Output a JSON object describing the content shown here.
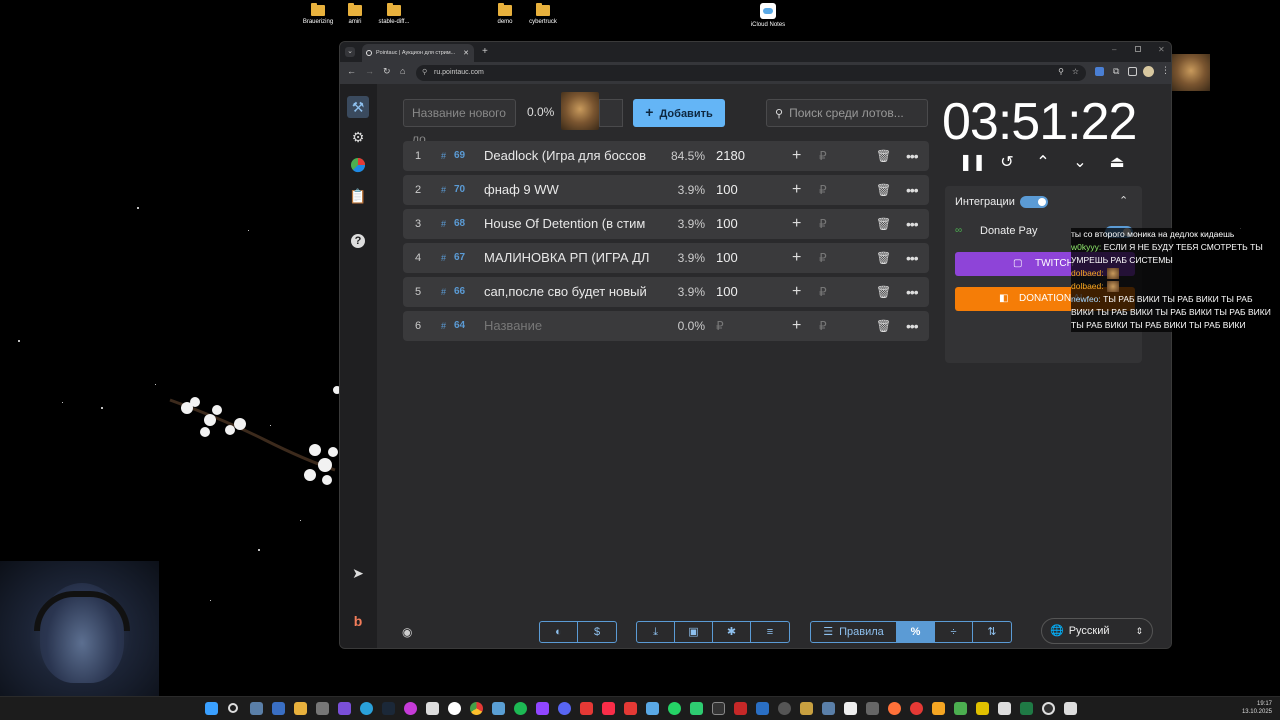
{
  "desktop": {
    "icons": [
      {
        "label": "Brauerizing"
      },
      {
        "label": "amiri"
      },
      {
        "label": "stable-diff..."
      },
      {
        "label": "demo"
      },
      {
        "label": "cybertruck"
      },
      {
        "label": "iCloud Notes"
      }
    ]
  },
  "browser": {
    "tab_title": "Pointauc | Аукцион для стрим...",
    "url": "ru.pointauc.com"
  },
  "toolbar": {
    "new_lot_placeholder": "Название нового ло",
    "new_lot_percent": "0.0%",
    "add_label": "Добавить",
    "search_placeholder": "Поиск среди лотов..."
  },
  "lots": [
    {
      "num": "1",
      "id": "69",
      "name": "Deadlock (Игра для боссов",
      "percent": "84.5%",
      "amount": "2180",
      "progress": 0.845
    },
    {
      "num": "2",
      "id": "70",
      "name": "фнаф 9 WW",
      "percent": "3.9%",
      "amount": "100",
      "progress": 0.039
    },
    {
      "num": "3",
      "id": "68",
      "name": "House Of Detention (в стим",
      "percent": "3.9%",
      "amount": "100",
      "progress": 0.039
    },
    {
      "num": "4",
      "id": "67",
      "name": "МАЛИНОВКА РП (ИГРА ДЛ",
      "percent": "3.9%",
      "amount": "100",
      "progress": 0.039
    },
    {
      "num": "5",
      "id": "66",
      "name": "сап,после сво будет новый",
      "percent": "3.9%",
      "amount": "100",
      "progress": 0.039
    },
    {
      "num": "6",
      "id": "64",
      "name": "Название",
      "percent": "0.0%",
      "amount": "₽",
      "progress": 0.0
    }
  ],
  "currency_symbol": "₽",
  "timer": "03:51:22",
  "integrations": {
    "title": "Интеграции",
    "donatepay_label": "Donate Pay",
    "twitch_label": "TWITCH",
    "donationalerts_label": "DONATION AL"
  },
  "bottom": {
    "rules_label": "Правила",
    "language": "Русский"
  },
  "chat": [
    {
      "user": "",
      "text": "ты со второго моника на дедлок кидаешь",
      "color": "#ffffff"
    },
    {
      "user": "w0kyyy:",
      "text": " ЕСЛИ Я НЕ БУДУ ТЕБЯ СМОТРЕТЬ ТЫ УМРЕШЬ РАБ СИСТЕМЫ",
      "color": "#8ee86a"
    },
    {
      "user": "dolbaed:",
      "text": "",
      "color": "#f5a623"
    },
    {
      "user": "dolbaed:",
      "text": "",
      "color": "#f5a623"
    },
    {
      "user": "newfeo:",
      "text": " ТЫ РАБ ВИКИ ТЫ РАБ ВИКИ ТЫ РАБ ВИКИ ТЫ РАБ ВИКИ ТЫ РАБ ВИКИ ТЫ РАБ ВИКИ ТЫ РАБ ВИКИ ТЫ РАБ ВИКИ ТЫ РАБ ВИКИ",
      "color": "#a8d8ff"
    }
  ],
  "clock": {
    "time": "19:17",
    "date": "13.10.2025"
  },
  "colors": {
    "accent": "#64b5f6",
    "twitch": "#8e44d8",
    "donationalerts": "#f57d07",
    "panel": "#2a2a2c"
  }
}
